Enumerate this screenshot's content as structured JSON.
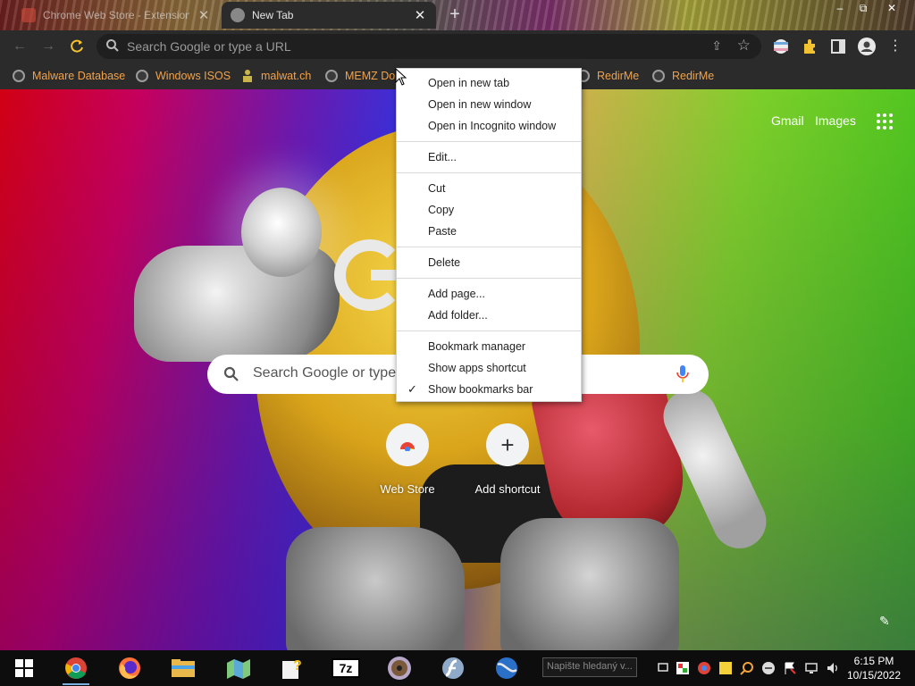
{
  "tabs": [
    {
      "title": "Chrome Web Store - Extensions",
      "active": false
    },
    {
      "title": "New Tab",
      "active": true
    }
  ],
  "window_controls": {
    "minimize": "–",
    "restore": "⧉",
    "close": "✕"
  },
  "omnibox": {
    "placeholder": "Search Google or type a URL"
  },
  "bookmarks": [
    {
      "label": "Malware Database",
      "icon": "globe-icon"
    },
    {
      "label": "Windows ISOS",
      "icon": "globe-icon"
    },
    {
      "label": "malwat.ch",
      "icon": "person-icon"
    },
    {
      "label": "MEMZ Do",
      "icon": "globe-icon"
    },
    {
      "label": "RedirMe",
      "icon": "globe-icon"
    },
    {
      "label": "RedirMe",
      "icon": "globe-icon"
    }
  ],
  "ntp": {
    "gmail": "Gmail",
    "images": "Images",
    "search_placeholder": "Search Google or type",
    "shortcuts": [
      {
        "label": "Web Store"
      },
      {
        "label": "Add shortcut"
      }
    ]
  },
  "context_menu": {
    "items": [
      {
        "label": "Open in new tab"
      },
      {
        "label": "Open in new window"
      },
      {
        "label": "Open in Incognito window"
      },
      {
        "label": "Edit..."
      },
      {
        "label": "Cut"
      },
      {
        "label": "Copy"
      },
      {
        "label": "Paste"
      },
      {
        "label": "Delete"
      },
      {
        "label": "Add page..."
      },
      {
        "label": "Add folder..."
      },
      {
        "label": "Bookmark manager"
      },
      {
        "label": "Show apps shortcut"
      },
      {
        "label": "Show bookmarks bar",
        "checked": true
      }
    ],
    "check_glyph": "✓"
  },
  "taskbar": {
    "search_placeholder": "Napište hledaný v...",
    "time": "6:15 PM",
    "date": "10/15/2022",
    "apps": [
      "start-icon",
      "chrome-icon",
      "firefox-icon",
      "file-explorer-icon",
      "maps-icon",
      "help-icon",
      "7zip-icon",
      "dvd-icon",
      "flash-icon",
      "earth-icon"
    ],
    "sevenzip_label": "7z"
  },
  "colors": {
    "bookmark_text": "#f2a34a",
    "toolbar_bg": "#2b2b2b",
    "reload_icon": "#f2c230"
  }
}
